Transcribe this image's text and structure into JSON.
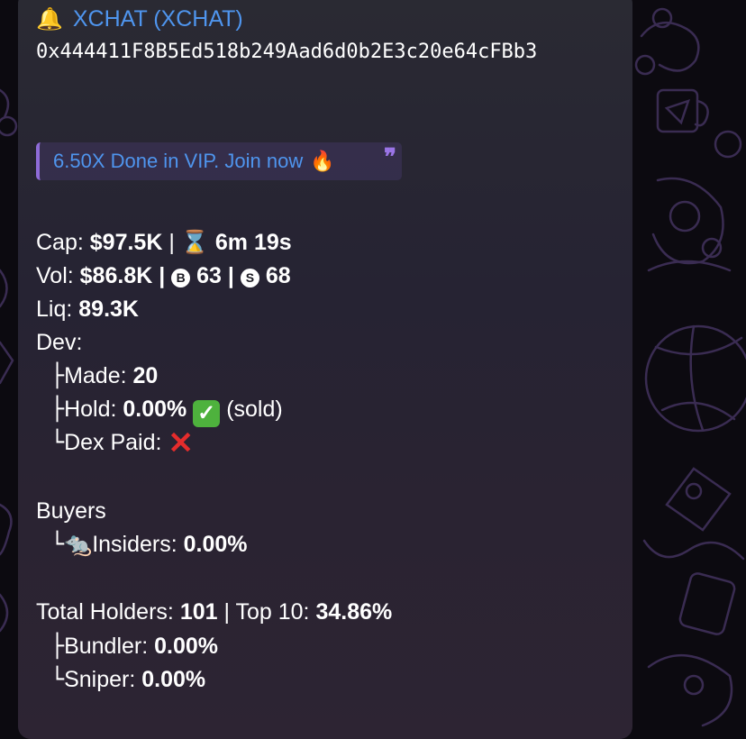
{
  "message": {
    "bell_icon": "🔔",
    "title": "XCHAT (XCHAT)",
    "address": "0x444411F8B5Ed518b249Aad6d0b2E3c20e64cFBb3",
    "quote": {
      "text": "6.50X Done in VIP. Join now",
      "fire_icon": "🔥",
      "quote_mark": "❞"
    },
    "cap": {
      "label": "Cap:",
      "value": "$97.5K",
      "sep": "|",
      "hourglass_icon": "⌛",
      "age": "6m 19s"
    },
    "vol": {
      "label": "Vol:",
      "value": "$86.8K",
      "sep": "|",
      "buy_badge": "B",
      "buys": "63",
      "sell_badge": "S",
      "sells": "68"
    },
    "liq": {
      "label": "Liq:",
      "value": "89.3K"
    },
    "dev": {
      "label": "Dev:",
      "made_prefix": "├",
      "made_label": "Made:",
      "made_value": "20",
      "hold_prefix": "├",
      "hold_label": "Hold:",
      "hold_value": "0.00%",
      "hold_check": "✓",
      "hold_note": "(sold)",
      "dex_prefix": "└",
      "dex_label": "Dex Paid:",
      "dex_icon": "✕"
    },
    "buyers": {
      "label": "Buyers",
      "insiders_prefix": "└",
      "rat_icon": "🐀",
      "insiders_label": "Insiders:",
      "insiders_value": "0.00%"
    },
    "holders": {
      "label": "Total Holders:",
      "value": "101",
      "sep": "|",
      "top10_label": "Top 10:",
      "top10_value": "34.86%",
      "bundler_prefix": "├",
      "bundler_label": "Bundler:",
      "bundler_value": "0.00%",
      "sniper_prefix": "└",
      "sniper_label": "Sniper:",
      "sniper_value": "0.00%"
    }
  },
  "colors": {
    "link": "#4f95ee",
    "quote_bar": "#8e6bd7",
    "check_green": "#4eb23d",
    "cross_red": "#e52c2c"
  }
}
